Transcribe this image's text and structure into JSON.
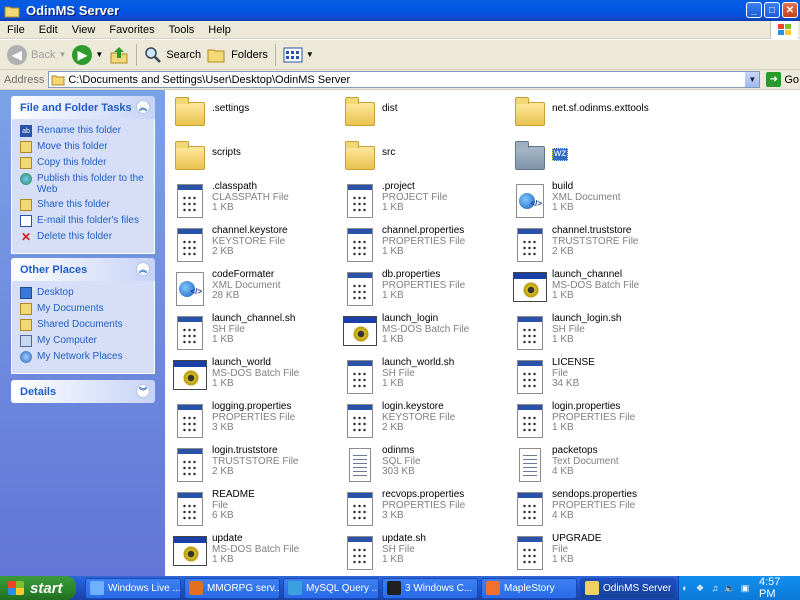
{
  "window": {
    "title": "OdinMS Server"
  },
  "menu": [
    "File",
    "Edit",
    "View",
    "Favorites",
    "Tools",
    "Help"
  ],
  "toolbar": {
    "back": "Back",
    "search": "Search",
    "folders": "Folders"
  },
  "address": {
    "label": "Address",
    "value": "C:\\Documents and Settings\\User\\Desktop\\OdinMS Server",
    "go": "Go"
  },
  "taskpane": {
    "file_tasks": {
      "title": "File and Folder Tasks",
      "links": [
        "Rename this folder",
        "Move this folder",
        "Copy this folder",
        "Publish this folder to the Web",
        "Share this folder",
        "E-mail this folder's files",
        "Delete this folder"
      ]
    },
    "other_places": {
      "title": "Other Places",
      "links": [
        "Desktop",
        "My Documents",
        "Shared Documents",
        "My Computer",
        "My Network Places"
      ]
    },
    "details": {
      "title": "Details"
    }
  },
  "files": [
    {
      "name": ".settings",
      "type": "",
      "size": "",
      "kind": "folder"
    },
    {
      "name": "dist",
      "type": "",
      "size": "",
      "kind": "folder"
    },
    {
      "name": "net.sf.odinms.exttools",
      "type": "",
      "size": "",
      "kind": "folder"
    },
    {
      "name": "scripts",
      "type": "",
      "size": "",
      "kind": "folder"
    },
    {
      "name": "src",
      "type": "",
      "size": "",
      "kind": "folder"
    },
    {
      "name": "wz",
      "type": "",
      "size": "",
      "kind": "folder-selected"
    },
    {
      "name": ".classpath",
      "type": "CLASSPATH File",
      "size": "1 KB",
      "kind": "doc"
    },
    {
      "name": ".project",
      "type": "PROJECT File",
      "size": "1 KB",
      "kind": "doc"
    },
    {
      "name": "build",
      "type": "XML Document",
      "size": "1 KB",
      "kind": "xml"
    },
    {
      "name": "channel.keystore",
      "type": "KEYSTORE File",
      "size": "2 KB",
      "kind": "doc"
    },
    {
      "name": "channel.properties",
      "type": "PROPERTIES File",
      "size": "1 KB",
      "kind": "doc"
    },
    {
      "name": "channel.truststore",
      "type": "TRUSTSTORE File",
      "size": "2 KB",
      "kind": "doc"
    },
    {
      "name": "codeFormater",
      "type": "XML Document",
      "size": "28 KB",
      "kind": "xml"
    },
    {
      "name": "db.properties",
      "type": "PROPERTIES File",
      "size": "1 KB",
      "kind": "doc"
    },
    {
      "name": "launch_channel",
      "type": "MS-DOS Batch File",
      "size": "1 KB",
      "kind": "bat"
    },
    {
      "name": "launch_channel.sh",
      "type": "SH File",
      "size": "1 KB",
      "kind": "doc"
    },
    {
      "name": "launch_login",
      "type": "MS-DOS Batch File",
      "size": "1 KB",
      "kind": "bat"
    },
    {
      "name": "launch_login.sh",
      "type": "SH File",
      "size": "1 KB",
      "kind": "doc"
    },
    {
      "name": "launch_world",
      "type": "MS-DOS Batch File",
      "size": "1 KB",
      "kind": "bat"
    },
    {
      "name": "launch_world.sh",
      "type": "SH File",
      "size": "1 KB",
      "kind": "doc"
    },
    {
      "name": "LICENSE",
      "type": "File",
      "size": "34 KB",
      "kind": "doc"
    },
    {
      "name": "logging.properties",
      "type": "PROPERTIES File",
      "size": "3 KB",
      "kind": "doc"
    },
    {
      "name": "login.keystore",
      "type": "KEYSTORE File",
      "size": "2 KB",
      "kind": "doc"
    },
    {
      "name": "login.properties",
      "type": "PROPERTIES File",
      "size": "1 KB",
      "kind": "doc"
    },
    {
      "name": "login.truststore",
      "type": "TRUSTSTORE File",
      "size": "2 KB",
      "kind": "doc"
    },
    {
      "name": "odinms",
      "type": "SQL File",
      "size": "303 KB",
      "kind": "txt"
    },
    {
      "name": "packetops",
      "type": "Text Document",
      "size": "4 KB",
      "kind": "txt"
    },
    {
      "name": "README",
      "type": "File",
      "size": "6 KB",
      "kind": "doc"
    },
    {
      "name": "recvops.properties",
      "type": "PROPERTIES File",
      "size": "3 KB",
      "kind": "doc"
    },
    {
      "name": "sendops.properties",
      "type": "PROPERTIES File",
      "size": "4 KB",
      "kind": "doc"
    },
    {
      "name": "update",
      "type": "MS-DOS Batch File",
      "size": "1 KB",
      "kind": "bat"
    },
    {
      "name": "update.sh",
      "type": "SH File",
      "size": "1 KB",
      "kind": "doc"
    },
    {
      "name": "UPGRADE",
      "type": "File",
      "size": "1 KB",
      "kind": "doc"
    }
  ],
  "taskbar": {
    "start": "start",
    "tasks": [
      {
        "label": "Windows Live ...",
        "color": "#6fb0ff"
      },
      {
        "label": "MMORPG serv...",
        "color": "#e07020"
      },
      {
        "label": "MySQL Query ...",
        "color": "#3aa0e0"
      },
      {
        "label": "3 Windows C...",
        "color": "#202020"
      },
      {
        "label": "MapleStory",
        "color": "#f07030"
      },
      {
        "label": "OdinMS Server",
        "color": "#f0d060"
      }
    ],
    "clock": "4:57 PM"
  }
}
